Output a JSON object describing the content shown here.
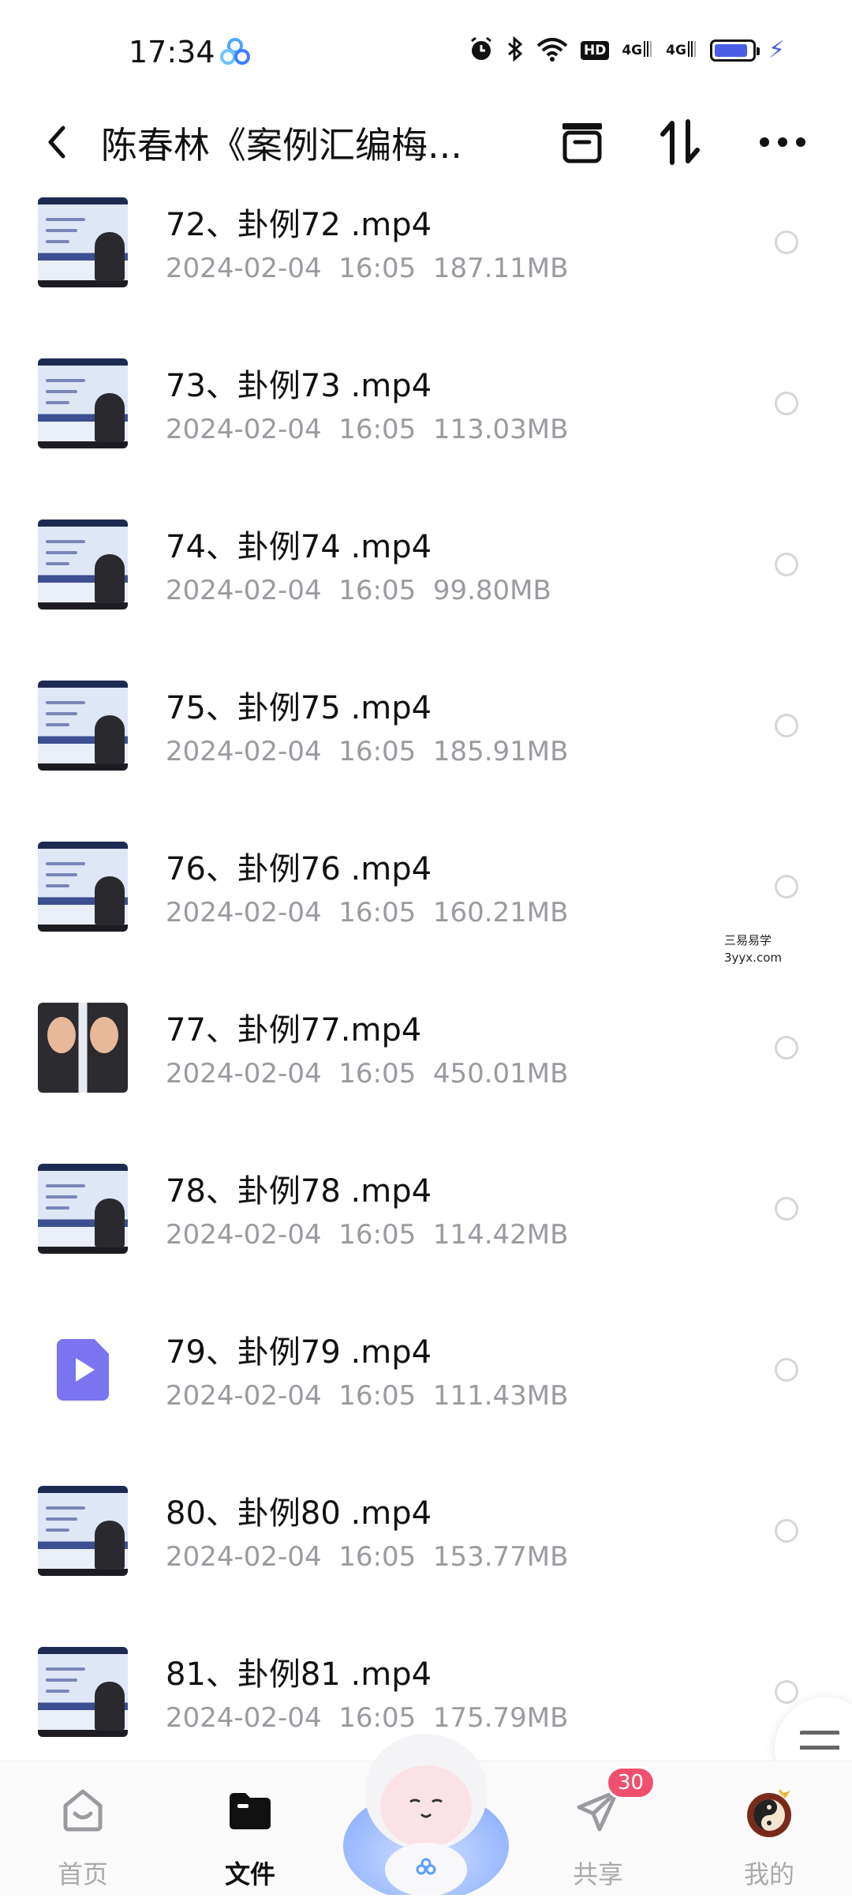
{
  "status_bar": {
    "time": "17:34",
    "icons": [
      "app-cloud-icon",
      "alarm-icon",
      "bluetooth-icon",
      "wifi-icon",
      "hd-badge",
      "signal-4g-icon",
      "signal-4g-icon",
      "battery-icon",
      "charging-icon"
    ],
    "hd_label": "HD",
    "net1": "4G",
    "net2": "4G",
    "battery_level": 0.9
  },
  "header": {
    "title": "陈春林《案例汇编梅...",
    "back_icon": "chevron-left-icon",
    "archive_icon": "archive-icon",
    "sort_icon": "sort-icon",
    "more_icon": "more-icon"
  },
  "files": [
    {
      "name": "72、卦例72 .mp4",
      "date": "2024-02-04",
      "time": "16:05",
      "size": "187.11MB",
      "thumb": "lecture"
    },
    {
      "name": "73、卦例73 .mp4",
      "date": "2024-02-04",
      "time": "16:05",
      "size": "113.03MB",
      "thumb": "lecture"
    },
    {
      "name": "74、卦例74 .mp4",
      "date": "2024-02-04",
      "time": "16:05",
      "size": "99.80MB",
      "thumb": "lecture"
    },
    {
      "name": "75、卦例75 .mp4",
      "date": "2024-02-04",
      "time": "16:05",
      "size": "185.91MB",
      "thumb": "lecture"
    },
    {
      "name": "76、卦例76 .mp4",
      "date": "2024-02-04",
      "time": "16:05",
      "size": "160.21MB",
      "thumb": "lecture"
    },
    {
      "name": "77、卦例77.mp4",
      "date": "2024-02-04",
      "time": "16:05",
      "size": "450.01MB",
      "thumb": "faces"
    },
    {
      "name": "78、卦例78 .mp4",
      "date": "2024-02-04",
      "time": "16:05",
      "size": "114.42MB",
      "thumb": "lecture"
    },
    {
      "name": "79、卦例79 .mp4",
      "date": "2024-02-04",
      "time": "16:05",
      "size": "111.43MB",
      "thumb": "video-icon"
    },
    {
      "name": "80、卦例80 .mp4",
      "date": "2024-02-04",
      "time": "16:05",
      "size": "153.77MB",
      "thumb": "lecture"
    },
    {
      "name": "81、卦例81 .mp4",
      "date": "2024-02-04",
      "time": "16:05",
      "size": "175.79MB",
      "thumb": "lecture"
    }
  ],
  "watermark": {
    "line1": "三易易学",
    "line2": "3yyx.com"
  },
  "bottom_nav": {
    "items": [
      {
        "label": "首页",
        "icon": "home-icon"
      },
      {
        "label": "文件",
        "icon": "folder-icon"
      },
      {
        "label": "",
        "icon": "mascot-icon"
      },
      {
        "label": "共享",
        "icon": "send-icon",
        "badge": "30"
      },
      {
        "label": "我的",
        "icon": "avatar-icon"
      }
    ]
  },
  "colors": {
    "accent": "#4b5de6",
    "badge": "#f0506e",
    "meta": "#9a9aa0",
    "video_icon": "#7b73f0"
  }
}
